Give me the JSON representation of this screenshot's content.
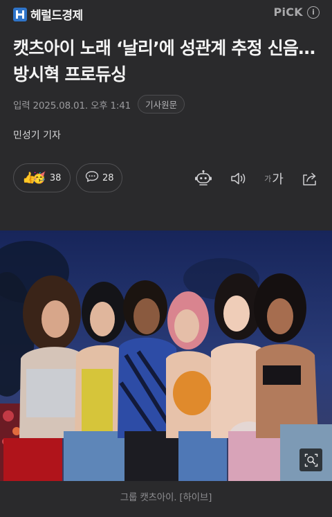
{
  "header": {
    "logo_text": "헤럴드경제",
    "pick_label": "PiCK",
    "info_glyph": "i"
  },
  "article": {
    "headline": "캣츠아이 노래 ‘날리’에 성관계 추정 신음…방시혁 프로듀싱",
    "date": "입력 2025.08.01. 오후 1:41",
    "source_button": "기사원문",
    "reporter": "민성기 기자"
  },
  "reactions": {
    "emojis": [
      "👍",
      "🥳"
    ],
    "count": "38"
  },
  "comments": {
    "icon": "speech-bubble-icon",
    "count": "28"
  },
  "toolbar": {
    "icons": [
      "summary-bot-icon",
      "speaker-icon",
      "font-size-icon",
      "share-icon"
    ],
    "font_small": "가",
    "font_large": "가"
  },
  "photo": {
    "caption": "그룹 캣츠아이. [하이브]",
    "zoom_icon": "zoom-icon"
  },
  "colors": {
    "background": "#2a2a2c",
    "logo_blue": "#2f74c9",
    "text_primary": "#f4f4f4",
    "text_secondary": "#9b9b9e"
  }
}
